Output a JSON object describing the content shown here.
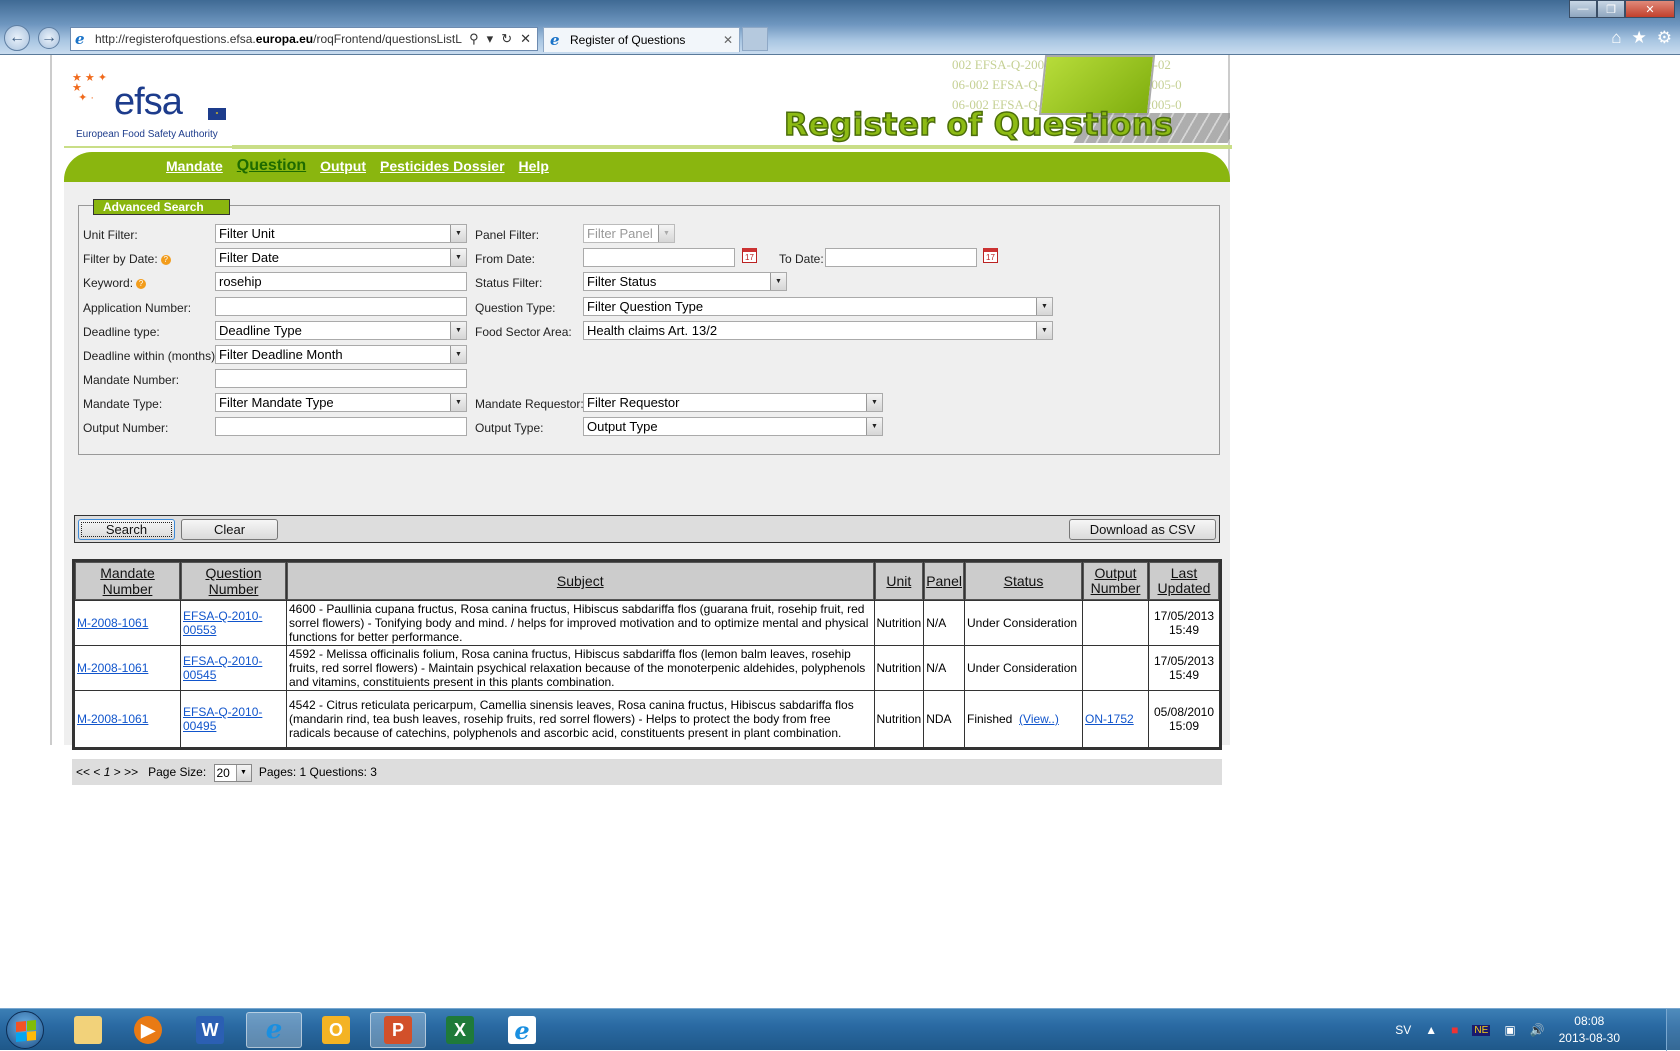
{
  "browser": {
    "window_buttons": [
      "minimize",
      "restore",
      "close"
    ],
    "address_url_prefix": "http://registerofquestions.efsa.",
    "address_url_bold": "europa.eu",
    "address_url_suffix": "/roqFrontend/questionsListL",
    "tab_title": "Register of Questions",
    "icons": [
      "home-icon",
      "favorites-star-icon",
      "tools-gear-icon"
    ]
  },
  "header": {
    "logo_text": "efsa",
    "logo_subtitle": "European Food Safety Authority",
    "banner_title": "Register of Questions",
    "banner_bg_text": [
      "002  EFSA-Q-2004-034  EFSA-Q-2005-02",
      "06-002  EFSA-Q-2004-034  EFSA-Q-2005-0",
      "06-002  EFSA-Q-2004-034  EFSA-Q-2005-0"
    ]
  },
  "menu": {
    "items": [
      {
        "label": "Mandate",
        "active": false
      },
      {
        "label": "Question",
        "active": true
      },
      {
        "label": "Output",
        "active": false
      },
      {
        "label": "Pesticides Dossier",
        "active": false
      },
      {
        "label": "Help",
        "active": false
      }
    ]
  },
  "search": {
    "legend": "Advanced Search",
    "unit_filter": {
      "label": "Unit Filter:",
      "value": "Filter Unit"
    },
    "filter_by_date": {
      "label": "Filter by Date:",
      "value": "Filter Date"
    },
    "keyword": {
      "label": "Keyword:",
      "value": "rosehip"
    },
    "application_number": {
      "label": "Application Number:",
      "value": ""
    },
    "deadline_type": {
      "label": "Deadline type:",
      "value": "Deadline Type"
    },
    "deadline_within": {
      "label": "Deadline within (months):",
      "value": "Filter Deadline Month"
    },
    "mandate_number": {
      "label": "Mandate Number:",
      "value": ""
    },
    "mandate_type": {
      "label": "Mandate Type:",
      "value": "Filter Mandate Type"
    },
    "output_number": {
      "label": "Output Number:",
      "value": ""
    },
    "panel_filter": {
      "label": "Panel Filter:",
      "value": "Filter Panel"
    },
    "from_date": {
      "label": "From Date:",
      "value": ""
    },
    "to_date": {
      "label": "To Date:",
      "value": ""
    },
    "status_filter": {
      "label": "Status Filter:",
      "value": "Filter Status"
    },
    "question_type": {
      "label": "Question Type:",
      "value": "Filter Question Type"
    },
    "food_sector_area": {
      "label": "Food Sector Area:",
      "value": "Health claims Art. 13/2"
    },
    "mandate_requestor": {
      "label": "Mandate Requestor:",
      "value": "Filter Requestor"
    },
    "output_type": {
      "label": "Output Type:",
      "value": "Output Type"
    },
    "calendar_icon_text": "17"
  },
  "buttons": {
    "search": "Search",
    "clear": "Clear",
    "download_csv": "Download as CSV"
  },
  "results": {
    "columns": [
      "Mandate Number",
      "Question Number",
      "Subject",
      "Unit",
      "Panel",
      "Status",
      "Output Number",
      "Last Updated"
    ],
    "rows": [
      {
        "mandate": "M-2008-1061",
        "question": "EFSA-Q-2010-00553",
        "subject": "4600 - Paullinia cupana fructus, Rosa canina fructus, Hibiscus sabdariffa flos (guarana fruit, rosehip fruit, red sorrel flowers) - Tonifying body and mind. / helps for improved motivation and to optimize mental and physical functions for better performance.",
        "unit": "Nutrition",
        "panel": "N/A",
        "status": "Under Consideration",
        "status_link": "",
        "output": "",
        "updated_date": "17/05/2013",
        "updated_time": "15:49"
      },
      {
        "mandate": "M-2008-1061",
        "question": "EFSA-Q-2010-00545",
        "subject": "4592 - Melissa officinalis folium, Rosa canina fructus, Hibiscus sabdariffa flos (lemon balm leaves, rosehip fruits, red sorrel flowers) - Maintain psychical relaxation because of the monoterpenic aldehides, polyphenols and vitamins, constituients present in this plants combination.",
        "unit": "Nutrition",
        "panel": "N/A",
        "status": "Under Consideration",
        "status_link": "",
        "output": "",
        "updated_date": "17/05/2013",
        "updated_time": "15:49"
      },
      {
        "mandate": "M-2008-1061",
        "question": "EFSA-Q-2010-00495",
        "subject": "4542 - Citrus reticulata pericarpum, Camellia sinensis leaves, Rosa canina fructus, Hibiscus sabdariffa flos (mandarin rind, tea bush leaves, rosehip fruits, red sorrel flowers) - Helps to protect the body from free radicals because of catechins, polyphenols and ascorbic acid, constituents present in plant combination.",
        "unit": "Nutrition",
        "panel": "NDA",
        "status": "Finished",
        "status_link": "(View..)",
        "output": "ON-1752",
        "updated_date": "05/08/2010",
        "updated_time": "15:09"
      }
    ]
  },
  "pager": {
    "nav": "<< <",
    "current_page": "1",
    "nav_next": "> >>",
    "page_size_label": "Page Size:",
    "page_size": "20",
    "summary": "Pages: 1 Questions: 3"
  },
  "taskbar": {
    "apps": [
      "windows-explorer",
      "media-player",
      "word",
      "internet-explorer",
      "outlook",
      "powerpoint",
      "excel",
      "internet-explorer-2"
    ],
    "language": "SV",
    "time": "08:08",
    "date": "2013-08-30"
  }
}
